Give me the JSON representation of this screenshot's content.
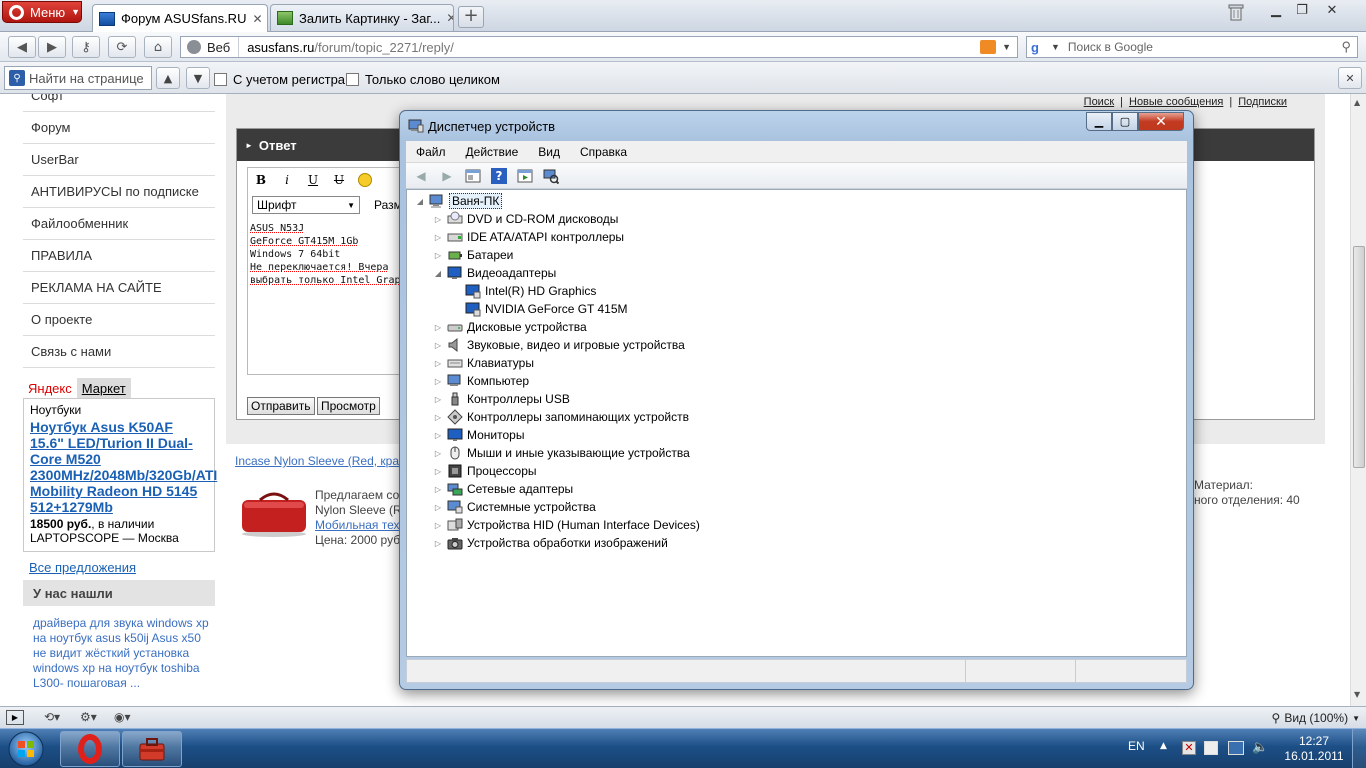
{
  "browser": {
    "menu_label": "Меню",
    "tabs": [
      {
        "label": "Форум ASUSfans.RU",
        "active": true
      },
      {
        "label": "Залить Картинку - Заг...",
        "active": false
      }
    ],
    "address": {
      "mode_label": "Веб",
      "host": "asusfans.ru",
      "path": "/forum/topic_2271/reply/"
    },
    "search_placeholder": "Поиск в Google",
    "find": {
      "placeholder": "Найти на странице",
      "match_case": "С учетом регистра",
      "whole_word": "Только слово целиком"
    },
    "zoom_label": "Вид (100%)"
  },
  "forum": {
    "sidebar_items": [
      "Софт",
      "Форум",
      "UserBar",
      "АНТИВИРУСЫ по подписке",
      "Файлообменник",
      "ПРАВИЛА",
      "РЕКЛАМА НА САЙТЕ",
      "О проекте",
      "Связь с нами"
    ],
    "yandex_tab": "Яндекс",
    "market_tab": "Маркет",
    "ad": {
      "category": "Ноутбуки",
      "title": "Ноутбук Asus K50AF 15.6\" LED/Turion II Dual-Core M520 2300MHz/2048Mb/320Gb/ATI Mobility Radeon HD 5145 512+1279Mb",
      "price": "18500 руб.",
      "availability": ", в наличии",
      "shop": "LAPTOPSCOPE — Москва"
    },
    "all_offers": "Все предложения",
    "found_header": "У нас нашли",
    "found_text": "драйвера для звука windows xp на ноутбук asus k50ij Asus x50 не видит жёсткий установка windows xp на ноутбук toshiba L300- пошаговая ...",
    "top_links": [
      "Поиск",
      "Новые сообщения",
      "Подписки"
    ],
    "reply_header": "Ответ",
    "font_select": "Шрифт",
    "size_select": "Разм",
    "editor_lines": [
      "ASUS N53J",
      "GeForce GT415M 1Gb",
      "Windows 7 64bit",
      "",
      "Не переключается! Вчера",
      "выбрать только Intel Grap"
    ],
    "submit_label": "Отправить",
    "preview_label": "Просмотр",
    "product_link": "Incase Nylon Sleeve (Red, кра",
    "product_lines": [
      "Предлагаем со",
      "Nylon Sleeve (R"
    ],
    "product_category_link": "Мобильная тех",
    "product_price": "Цена: 2000 руб",
    "product_right": [
      "Материал:",
      "ного отделения: 40"
    ]
  },
  "device_manager": {
    "title": "Диспетчер устройств",
    "menu": [
      "Файл",
      "Действие",
      "Вид",
      "Справка"
    ],
    "root": "Ваня-ПК",
    "categories": [
      {
        "label": "DVD и CD-ROM дисководы",
        "icon": "dvd-drive-icon"
      },
      {
        "label": "IDE ATA/ATAPI контроллеры",
        "icon": "ide-controller-icon"
      },
      {
        "label": "Батареи",
        "icon": "battery-icon"
      },
      {
        "label": "Видеоадаптеры",
        "icon": "display-adapter-icon",
        "expanded": true,
        "children": [
          "Intel(R) HD Graphics",
          "NVIDIA GeForce GT 415M"
        ]
      },
      {
        "label": "Дисковые устройства",
        "icon": "disk-drive-icon"
      },
      {
        "label": "Звуковые, видео и игровые устройства",
        "icon": "speaker-icon"
      },
      {
        "label": "Клавиатуры",
        "icon": "keyboard-icon"
      },
      {
        "label": "Компьютер",
        "icon": "computer-icon"
      },
      {
        "label": "Контроллеры USB",
        "icon": "usb-icon"
      },
      {
        "label": "Контроллеры запоминающих устройств",
        "icon": "storage-controller-icon"
      },
      {
        "label": "Мониторы",
        "icon": "monitor-icon"
      },
      {
        "label": "Мыши и иные указывающие устройства",
        "icon": "mouse-icon"
      },
      {
        "label": "Процессоры",
        "icon": "cpu-icon"
      },
      {
        "label": "Сетевые адаптеры",
        "icon": "network-adapter-icon"
      },
      {
        "label": "Системные устройства",
        "icon": "system-devices-icon"
      },
      {
        "label": "Устройства HID (Human Interface Devices)",
        "icon": "hid-icon"
      },
      {
        "label": "Устройства обработки изображений",
        "icon": "imaging-icon"
      }
    ]
  },
  "taskbar": {
    "language": "EN",
    "time": "12:27",
    "date": "16.01.2011"
  },
  "colors": {
    "link": "#1a60b5",
    "reply_header_bg": "#3b3b3b",
    "taskbar": "#1c4f86",
    "window_frame": "#b5cbe3"
  }
}
